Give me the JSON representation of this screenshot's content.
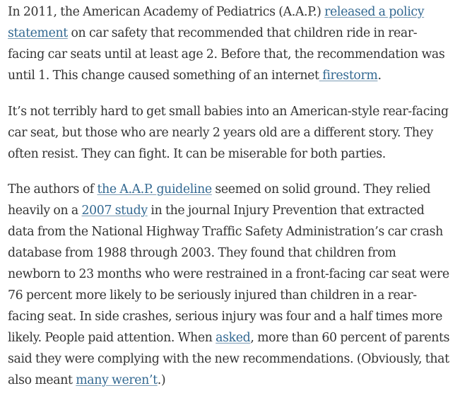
{
  "article": {
    "p1": {
      "t1": "In 2011, the American Academy of Pediatrics (A.A.P.)  ",
      "l1": "released a policy statement",
      "t2": " on car safety that recommended that children ride in rear-facing car seats until at least age 2. Before that, the recommendation was until 1. This change caused something of an internet",
      "l2": " firestorm",
      "t3": "."
    },
    "p2": {
      "t1": "It’s not terribly hard to get small babies into an American-style rear-facing car seat, but those  who are nearly 2 years old are a different story. They often resist. They can fight. It can be miserable for both parties."
    },
    "p3": {
      "t1": "The authors of ",
      "l1": "the A.A.P. guideline",
      "t2": " seemed on solid ground. They relied heavily on a ",
      "l2": "2007 study",
      "t3": " in the journal Injury Prevention that extracted data from the National Highway Traffic Safety Administration’s car crash database from 1988 through 2003. They found that children from newborn to 23 months who were restrained in a front-facing car seat were 76 percent more likely to be seriously injured than children in a rear-facing seat. In side crashes, serious injury was four and a half times more likely. People paid attention. When ",
      "l3": "asked",
      "t4": ", more than 60 percent of parents said they were complying with the new recommendations. (Obviously, that also meant ",
      "l4": "many weren’t",
      "t5": ".)"
    }
  }
}
